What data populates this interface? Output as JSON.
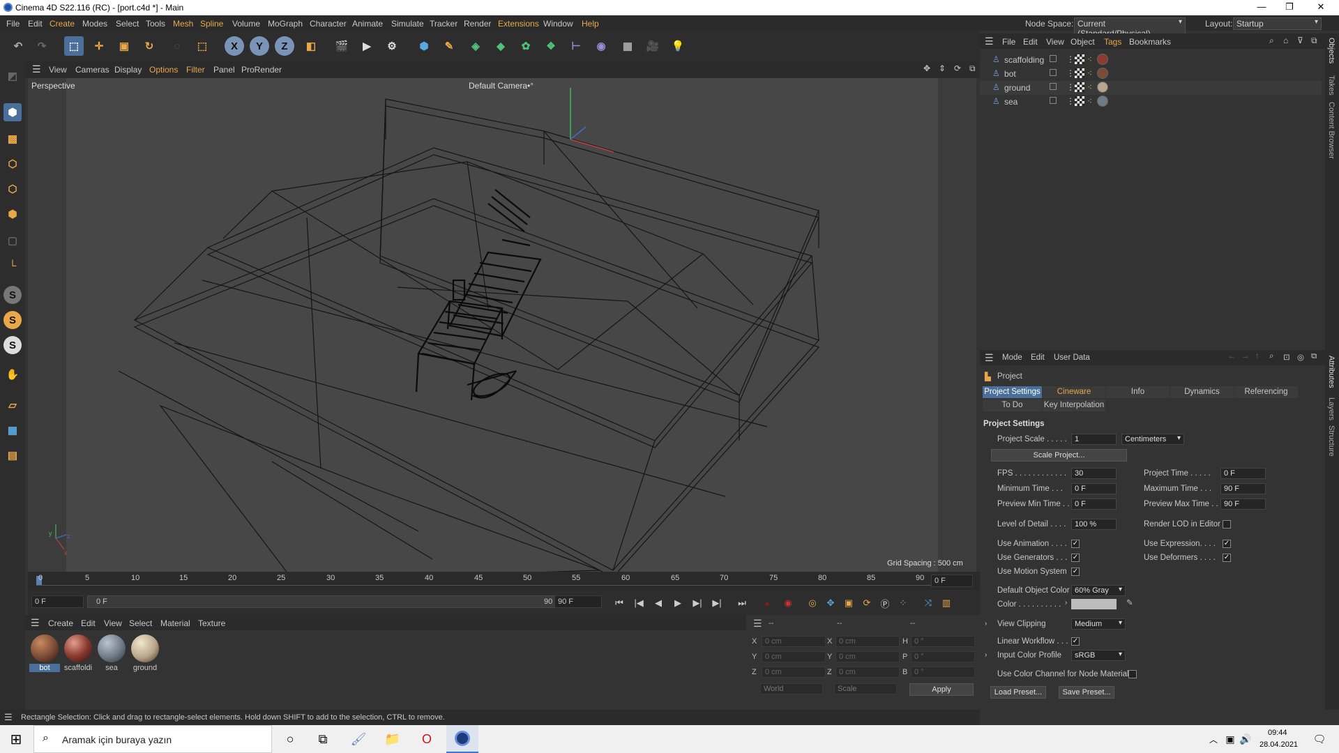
{
  "window": {
    "title": "Cinema 4D S22.116 (RC) - [port.c4d *] - Main",
    "min": "—",
    "max": "❐",
    "close": "✕"
  },
  "menubar": {
    "items": [
      "File",
      "Edit",
      "Create",
      "Modes",
      "Select",
      "Tools",
      "Mesh",
      "Spline",
      "Volume",
      "MoGraph",
      "Character",
      "Animate",
      "Simulate",
      "Tracker",
      "Render",
      "Extensions",
      "Window",
      "Help"
    ],
    "node_space_label": "Node Space:",
    "node_space_value": "Current (Standard/Physical)",
    "layout_label": "Layout:",
    "layout_value": "Startup"
  },
  "toolbar": {
    "axis_x": "X",
    "axis_y": "Y",
    "axis_z": "Z"
  },
  "left_tools": {
    "s1": "S",
    "s2": "S",
    "s3": "S"
  },
  "viewport_menu": {
    "items": [
      "View",
      "Cameras",
      "Display",
      "Options",
      "Filter",
      "Panel",
      "ProRender"
    ]
  },
  "viewport": {
    "name": "Perspective",
    "camera": "Default Camera",
    "camera_suffix": "•°",
    "grid_spacing": "Grid Spacing : 500 cm",
    "axis_y": "y",
    "axis_z": "z",
    "axis_x": "x"
  },
  "timeline": {
    "ticks": [
      "0",
      "5",
      "10",
      "15",
      "20",
      "25",
      "30",
      "35",
      "40",
      "45",
      "50",
      "55",
      "60",
      "65",
      "70",
      "75",
      "80",
      "85",
      "90"
    ],
    "current": "0 F"
  },
  "transport": {
    "start_field": "0 F",
    "range_start": "0 F",
    "range_end": "90 F",
    "end_field": "90 F"
  },
  "material_manager": {
    "menu": [
      "Create",
      "Edit",
      "View",
      "Select",
      "Material",
      "Texture"
    ],
    "materials": [
      {
        "name": "bot",
        "color": "#7a4a35"
      },
      {
        "name": "scaffoldi",
        "color": "#8c3a30"
      },
      {
        "name": "sea",
        "color": "#6f7a86"
      },
      {
        "name": "ground",
        "color": "#b8a68a"
      }
    ]
  },
  "coordinates": {
    "header_cols": [
      "--",
      "--",
      "--"
    ],
    "rows": [
      {
        "a": "X",
        "av": "0 cm",
        "b": "X",
        "bv": "0 cm",
        "c": "H",
        "cv": "0 °"
      },
      {
        "a": "Y",
        "av": "0 cm",
        "b": "Y",
        "bv": "0 cm",
        "c": "P",
        "cv": "0 °"
      },
      {
        "a": "Z",
        "av": "0 cm",
        "b": "Z",
        "bv": "0 cm",
        "c": "B",
        "cv": "0 °"
      }
    ],
    "space": "World",
    "mode": "Scale",
    "apply": "Apply"
  },
  "statusbar": {
    "text": "Rectangle Selection: Click and drag to rectangle-select elements. Hold down SHIFT to add to the selection, CTRL to remove."
  },
  "object_manager": {
    "menu": [
      "File",
      "Edit",
      "View",
      "Object",
      "Tags",
      "Bookmarks"
    ],
    "objects": [
      "scaffolding",
      "bot",
      "ground",
      "sea"
    ]
  },
  "attributes": {
    "menu": [
      "Mode",
      "Edit",
      "User Data"
    ],
    "object": "Project",
    "tabs": [
      "Project Settings",
      "Cineware",
      "Info",
      "Dynamics",
      "Referencing"
    ],
    "tabs2": [
      "To Do",
      "Key Interpolation"
    ],
    "section": "Project Settings",
    "project_scale_label": "Project Scale . . . . .",
    "project_scale_value": "1",
    "project_scale_unit": "Centimeters",
    "scale_project_btn": "Scale Project...",
    "fps_label": "FPS . . . . . . . . . . . .",
    "fps_value": "30",
    "project_time_label": "Project Time . . . . .",
    "project_time_value": "0 F",
    "min_time_label": "Minimum Time . . .",
    "min_time_value": "0 F",
    "max_time_label": "Maximum Time . . .",
    "max_time_value": "90 F",
    "prev_min_label": "Preview Min Time . .",
    "prev_min_value": "0 F",
    "prev_max_label": "Preview Max Time . .",
    "prev_max_value": "90 F",
    "lod_label": "Level of Detail . . . .",
    "lod_value": "100 %",
    "render_lod_label": "Render LOD in Editor",
    "use_anim_label": "Use Animation . . . .",
    "use_expr_label": "Use Expression. . . .",
    "use_gen_label": "Use Generators . . .",
    "use_def_label": "Use Deformers . . . .",
    "use_motion_label": "Use Motion System",
    "def_obj_color_label": "Default Object Color",
    "def_obj_color_value": "60% Gray",
    "color_label": "Color . . . . . . . . . .",
    "view_clip_label": "View Clipping",
    "view_clip_value": "Medium",
    "linear_wf_label": "Linear Workflow . . .",
    "input_profile_label": "Input Color Profile",
    "input_profile_value": "sRGB",
    "use_color_channel_label": "Use Color Channel for Node Material",
    "load_preset": "Load Preset...",
    "save_preset": "Save Preset..."
  },
  "side_tabs": [
    "Objects",
    "Takes",
    "Content Browser",
    "Attributes",
    "Layers",
    "Structure"
  ],
  "taskbar": {
    "search_placeholder": "Aramak için buraya yazın",
    "time": "09:44",
    "date": "28.04.2021"
  }
}
